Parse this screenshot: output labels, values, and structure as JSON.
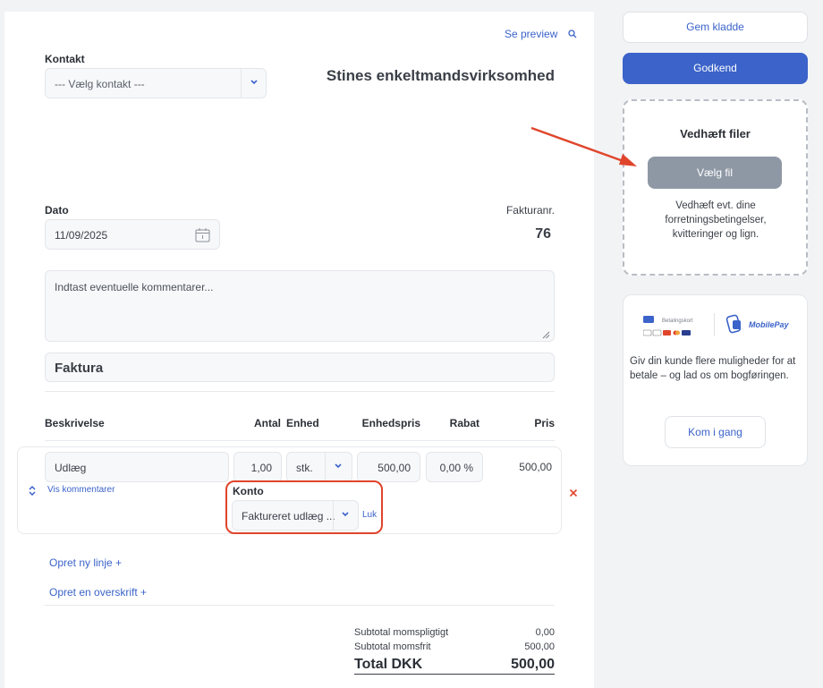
{
  "header": {
    "preview_link": "Se preview",
    "company_name": "Stines enkeltmandsvirksomhed"
  },
  "contact": {
    "label": "Kontakt",
    "placeholder": "--- Vælg kontakt ---"
  },
  "date": {
    "label": "Dato",
    "value": "11/09/2025"
  },
  "invoice_number": {
    "label": "Fakturanr.",
    "value": "76"
  },
  "comments": {
    "placeholder": "Indtast eventuelle kommentarer..."
  },
  "document_title": "Faktura",
  "table": {
    "headers": {
      "description": "Beskrivelse",
      "quantity": "Antal",
      "unit": "Enhed",
      "unit_price": "Enhedspris",
      "discount": "Rabat",
      "price": "Pris"
    },
    "rows": [
      {
        "description": "Udlæg",
        "quantity": "1,00",
        "unit": "stk.",
        "unit_price": "500,00",
        "discount": "0,00 %",
        "price": "500,00",
        "show_comments": "Vis kommentarer",
        "account_label": "Konto",
        "account_value": "Faktureret udlæg ...",
        "close_link": "Luk"
      }
    ]
  },
  "actions": {
    "new_line": "Opret ny linje +",
    "new_heading": "Opret en overskrift +"
  },
  "totals": {
    "subtotal_vat_label": "Subtotal momspligtigt",
    "subtotal_vat_value": "0,00",
    "subtotal_free_label": "Subtotal momsfrit",
    "subtotal_free_value": "500,00",
    "total_label": "Total DKK",
    "total_value": "500,00"
  },
  "sidebar": {
    "save_draft": "Gem kladde",
    "approve": "Godkend",
    "attach_title": "Vedhæft filer",
    "choose_file": "Vælg fil",
    "attach_help": "Vedhæft evt. dine forretningsbetingelser, kvitteringer og lign.",
    "payment_card_label": "Betalingskort",
    "mobilepay_label": "MobilePay",
    "promo_text": "Giv din kunde flere muligheder for at betale – og lad os om bogføringen.",
    "get_started": "Kom i gang"
  },
  "colors": {
    "accent": "#3b63c9",
    "annotation_red": "#e0452c",
    "choose_file_bg": "#8e98a5"
  }
}
